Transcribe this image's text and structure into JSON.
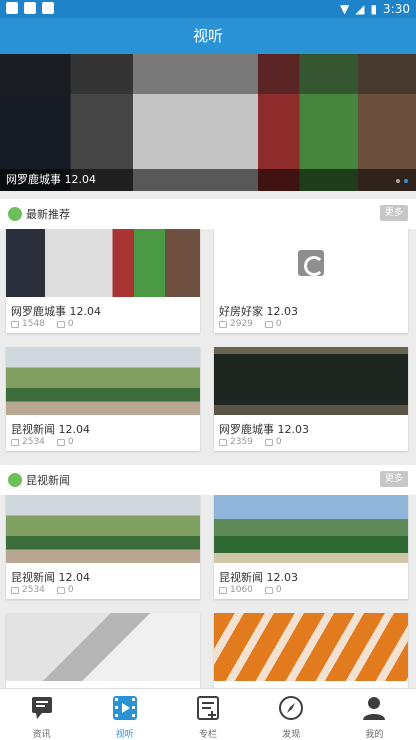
{
  "status_bar": {
    "time": "3:30"
  },
  "app_bar": {
    "title": "视听"
  },
  "hero": {
    "caption": "网罗鹿城事 12.04"
  },
  "sections": [
    {
      "title": "最新推荐",
      "more": "更多",
      "cards": [
        {
          "title": "网罗鹿城事 12.04",
          "views": "1548",
          "comments": "0"
        },
        {
          "title": "好房好家 12.03",
          "views": "2929",
          "comments": "0"
        },
        {
          "title": "昆视新闻 12.04",
          "views": "2534",
          "comments": "0"
        },
        {
          "title": "网罗鹿城事 12.03",
          "views": "2359",
          "comments": "0"
        }
      ]
    },
    {
      "title": "昆视新闻",
      "more": "更多",
      "cards": [
        {
          "title": "昆视新闻 12.04",
          "views": "2534",
          "comments": "0"
        },
        {
          "title": "昆视新闻 12.03",
          "views": "1060",
          "comments": "0"
        },
        {
          "title": "",
          "views": "",
          "comments": ""
        },
        {
          "title": "",
          "views": "",
          "comments": ""
        }
      ]
    }
  ],
  "tabs": [
    {
      "label": "资讯",
      "icon": "news-icon"
    },
    {
      "label": "视听",
      "icon": "video-icon",
      "active": true
    },
    {
      "label": "专栏",
      "icon": "column-icon"
    },
    {
      "label": "发现",
      "icon": "compass-icon"
    },
    {
      "label": "我的",
      "icon": "user-icon"
    }
  ],
  "colors": {
    "primary": "#2a93d5",
    "status_bar": "#1e83c9",
    "section_icon": "#6dbf5a"
  }
}
